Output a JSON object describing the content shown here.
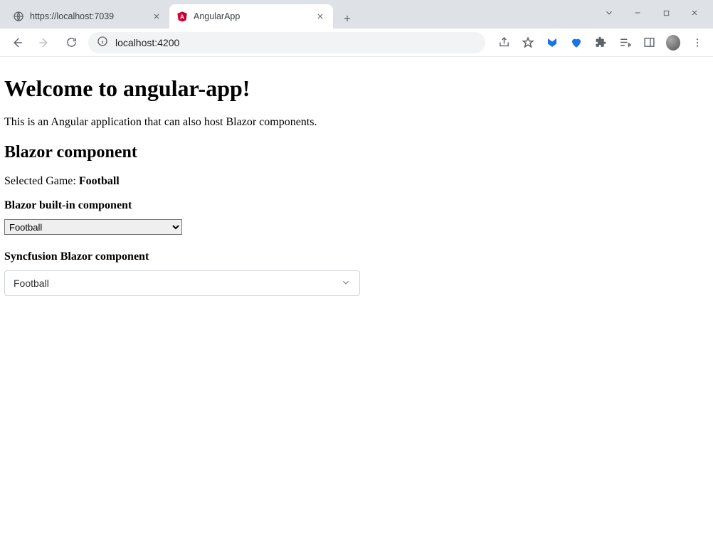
{
  "window": {
    "tabs": [
      {
        "title": "https://localhost:7039",
        "active": false
      },
      {
        "title": "AngularApp",
        "active": true
      }
    ],
    "address": "localhost:4200"
  },
  "page": {
    "heading": "Welcome to angular-app!",
    "description": "This is an Angular application that can also host Blazor components.",
    "section_title": "Blazor component",
    "selected_label": "Selected Game: ",
    "selected_value": "Football",
    "builtin_label": "Blazor built-in component",
    "builtin_select_value": "Football",
    "syncfusion_label": "Syncfusion Blazor component",
    "syncfusion_value": "Football"
  }
}
